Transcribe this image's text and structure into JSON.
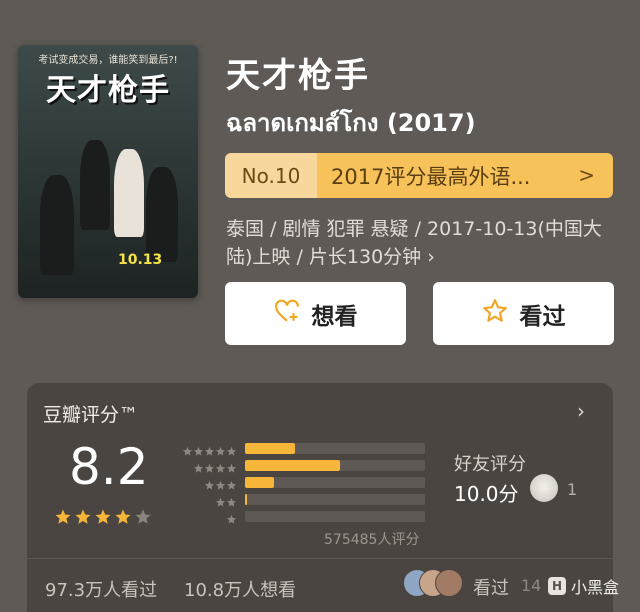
{
  "poster": {
    "tagline": "考试变成交易，谁能笑到最后?!",
    "title": "天才枪手",
    "date": "10.13"
  },
  "movie": {
    "title_zh": "天才枪手",
    "title_orig": "ฉลาดเกมส์โกง (2017)",
    "rank_no": "No.10",
    "rank_label": "2017评分最高外语...",
    "meta": "泰国 / 剧情 犯罪 悬疑 / 2017-10-13(中国大陆)上映 / 片长130分钟 ›"
  },
  "actions": {
    "want_label": "想看",
    "seen_label": "看过"
  },
  "rating": {
    "header": "豆瓣评分™",
    "score": "8.2",
    "stars": 4,
    "distribution": [
      0.28,
      0.53,
      0.16,
      0.01,
      0.0
    ],
    "votes": "575485人评分",
    "friend_label": "好友评分",
    "friend_score": "10.0分",
    "friend_count": "1",
    "watched": "97.3万人看过",
    "want": "10.8万人想看",
    "seen_label": "看过",
    "seen_count": "14"
  },
  "colors": {
    "accent": "#f5b63a",
    "rank_bg": "#f7c25a"
  },
  "watermark": "小黑盒"
}
